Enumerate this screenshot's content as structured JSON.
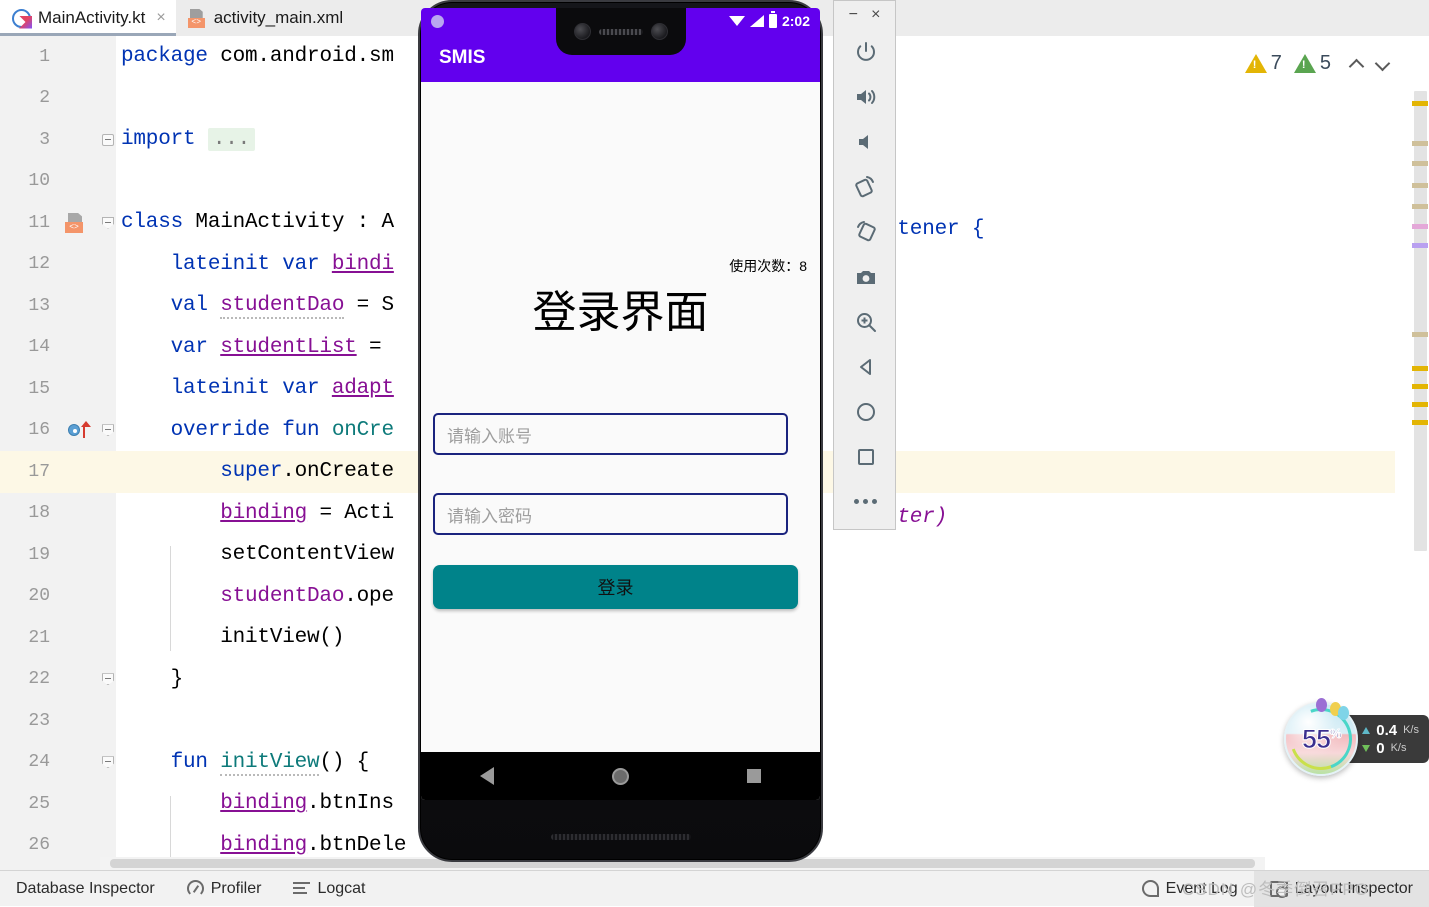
{
  "tabs": [
    {
      "label": "MainActivity.kt",
      "icon": "kotlin-file-icon",
      "active": true,
      "close": "×"
    },
    {
      "label": "activity_main.xml",
      "icon": "xml-layout-file-icon",
      "active": false,
      "close": "×"
    }
  ],
  "editor": {
    "lines": [
      {
        "num": "1",
        "segments": [
          {
            "t": "package",
            "c": "k"
          },
          {
            "t": " com.android.sm",
            "c": "d"
          }
        ]
      },
      {
        "num": "2",
        "segments": []
      },
      {
        "num": "3",
        "segments": [
          {
            "t": "import",
            "c": "k"
          },
          {
            "t": " ",
            "c": "d"
          },
          {
            "t": "...",
            "c": "fold-ph"
          }
        ],
        "fold": "plus"
      },
      {
        "num": "10",
        "segments": []
      },
      {
        "num": "11",
        "segments": [
          {
            "t": "class",
            "c": "k"
          },
          {
            "t": " MainActivity : A",
            "c": "d"
          }
        ],
        "fold": "minus",
        "gutter": "class-marker-icon"
      },
      {
        "num": "12",
        "segments": [
          {
            "t": "    lateinit var ",
            "c": "k"
          },
          {
            "t": "bindi",
            "c": "p u"
          }
        ]
      },
      {
        "num": "13",
        "segments": [
          {
            "t": "    val ",
            "c": "k"
          },
          {
            "t": "studentDao",
            "c": "p sq"
          },
          {
            "t": " = S",
            "c": "d"
          }
        ]
      },
      {
        "num": "14",
        "segments": [
          {
            "t": "    var ",
            "c": "k"
          },
          {
            "t": "studentList",
            "c": "p u"
          },
          {
            "t": " = ",
            "c": "d"
          }
        ]
      },
      {
        "num": "15",
        "segments": [
          {
            "t": "    lateinit var ",
            "c": "k"
          },
          {
            "t": "adapt",
            "c": "p u"
          }
        ]
      },
      {
        "num": "16",
        "segments": [
          {
            "t": "    override fun ",
            "c": "k"
          },
          {
            "t": "onCre",
            "c": "t"
          }
        ],
        "fold": "minus",
        "gutter": "override-method-icon"
      },
      {
        "num": "17",
        "segments": [
          {
            "t": "        super",
            "c": "k"
          },
          {
            "t": ".onCreate",
            "c": "d"
          }
        ],
        "highlight": true
      },
      {
        "num": "18",
        "segments": [
          {
            "t": "        ",
            "c": "d"
          },
          {
            "t": "binding",
            "c": "p u"
          },
          {
            "t": " = Acti",
            "c": "d"
          }
        ]
      },
      {
        "num": "19",
        "segments": [
          {
            "t": "        setContentView",
            "c": "d"
          }
        ]
      },
      {
        "num": "20",
        "segments": [
          {
            "t": "        ",
            "c": "d"
          },
          {
            "t": "studentDao",
            "c": "p"
          },
          {
            "t": ".ope",
            "c": "d"
          }
        ]
      },
      {
        "num": "21",
        "segments": [
          {
            "t": "        initView()",
            "c": "d"
          }
        ]
      },
      {
        "num": "22",
        "segments": [
          {
            "t": "    }",
            "c": "d"
          }
        ],
        "fold": "minus"
      },
      {
        "num": "23",
        "segments": []
      },
      {
        "num": "24",
        "segments": [
          {
            "t": "    fun ",
            "c": "k"
          },
          {
            "t": "initView",
            "c": "t sq"
          },
          {
            "t": "() {",
            "c": "d"
          }
        ],
        "fold": "minus"
      },
      {
        "num": "25",
        "segments": [
          {
            "t": "        ",
            "c": "d"
          },
          {
            "t": "binding",
            "c": "p u"
          },
          {
            "t": ".btnIns",
            "c": "d"
          }
        ]
      },
      {
        "num": "26",
        "segments": [
          {
            "t": "        ",
            "c": "d"
          },
          {
            "t": "binding",
            "c": "p u"
          },
          {
            "t": ".btnDele",
            "c": "d"
          }
        ]
      }
    ],
    "overflow_line11": "stener {",
    "overflow_line18": "ater)"
  },
  "inspections": {
    "warning_icon": "warning-triangle-icon",
    "warning_count": "7",
    "weak_icon": "weak-warning-triangle-icon",
    "weak_count": "5",
    "prev_icon": "chevron-up-icon",
    "next_icon": "chevron-down-icon"
  },
  "emulator": {
    "window": {
      "minimize": "−",
      "close": "×"
    },
    "buttons": [
      {
        "name": "power-icon",
        "label": "Power"
      },
      {
        "name": "volume-up-icon",
        "label": "Volume Up"
      },
      {
        "name": "volume-down-icon",
        "label": "Volume Down"
      },
      {
        "name": "rotate-left-icon",
        "label": "Rotate Left"
      },
      {
        "name": "rotate-right-icon",
        "label": "Rotate Right"
      },
      {
        "name": "camera-icon",
        "label": "Take Screenshot"
      },
      {
        "name": "zoom-icon",
        "label": "Zoom Mode"
      },
      {
        "name": "back-icon",
        "label": "Back"
      },
      {
        "name": "home-icon",
        "label": "Home"
      },
      {
        "name": "overview-icon",
        "label": "Overview"
      },
      {
        "name": "more-icon",
        "label": "More"
      }
    ]
  },
  "device": {
    "status": {
      "time": "2:02",
      "wifi_icon": "wifi-off-icon",
      "signal_icon": "cellular-signal-icon",
      "battery_icon": "battery-icon"
    },
    "appbar": {
      "title": "SMIS"
    },
    "screen": {
      "usage_label": "使用次数：",
      "usage_count": "8",
      "title": "登录界面",
      "account_placeholder": "请输入账号",
      "account_value": "",
      "password_placeholder": "请输入密码",
      "password_value": "",
      "login_button": "登录"
    },
    "navbar": {
      "back": "back-triangle-icon",
      "home": "home-circle-icon",
      "recent": "recent-square-icon"
    },
    "colors": {
      "primary": "#6200EE",
      "button": "#00838A",
      "input_border": "#1A237E"
    }
  },
  "bottom_bar": {
    "left": [
      {
        "label": "Database Inspector",
        "icon": "database-inspector-icon",
        "selected": false
      },
      {
        "label": "Profiler",
        "icon": "profiler-gauge-icon",
        "selected": false
      },
      {
        "label": "Logcat",
        "icon": "logcat-lines-icon",
        "selected": false
      }
    ],
    "right": [
      {
        "label": "Event Log",
        "icon": "event-log-icon",
        "selected": false
      },
      {
        "label": "Layout Inspector",
        "icon": "layout-inspector-icon",
        "selected": true
      }
    ]
  },
  "watermark": "CSDN @冬季倒召PPO",
  "network_widget": {
    "percent": "55",
    "percent_unit": "%",
    "upload_value": "0.4",
    "upload_unit": "K/s",
    "download_value": "0",
    "download_unit": "K/s"
  }
}
